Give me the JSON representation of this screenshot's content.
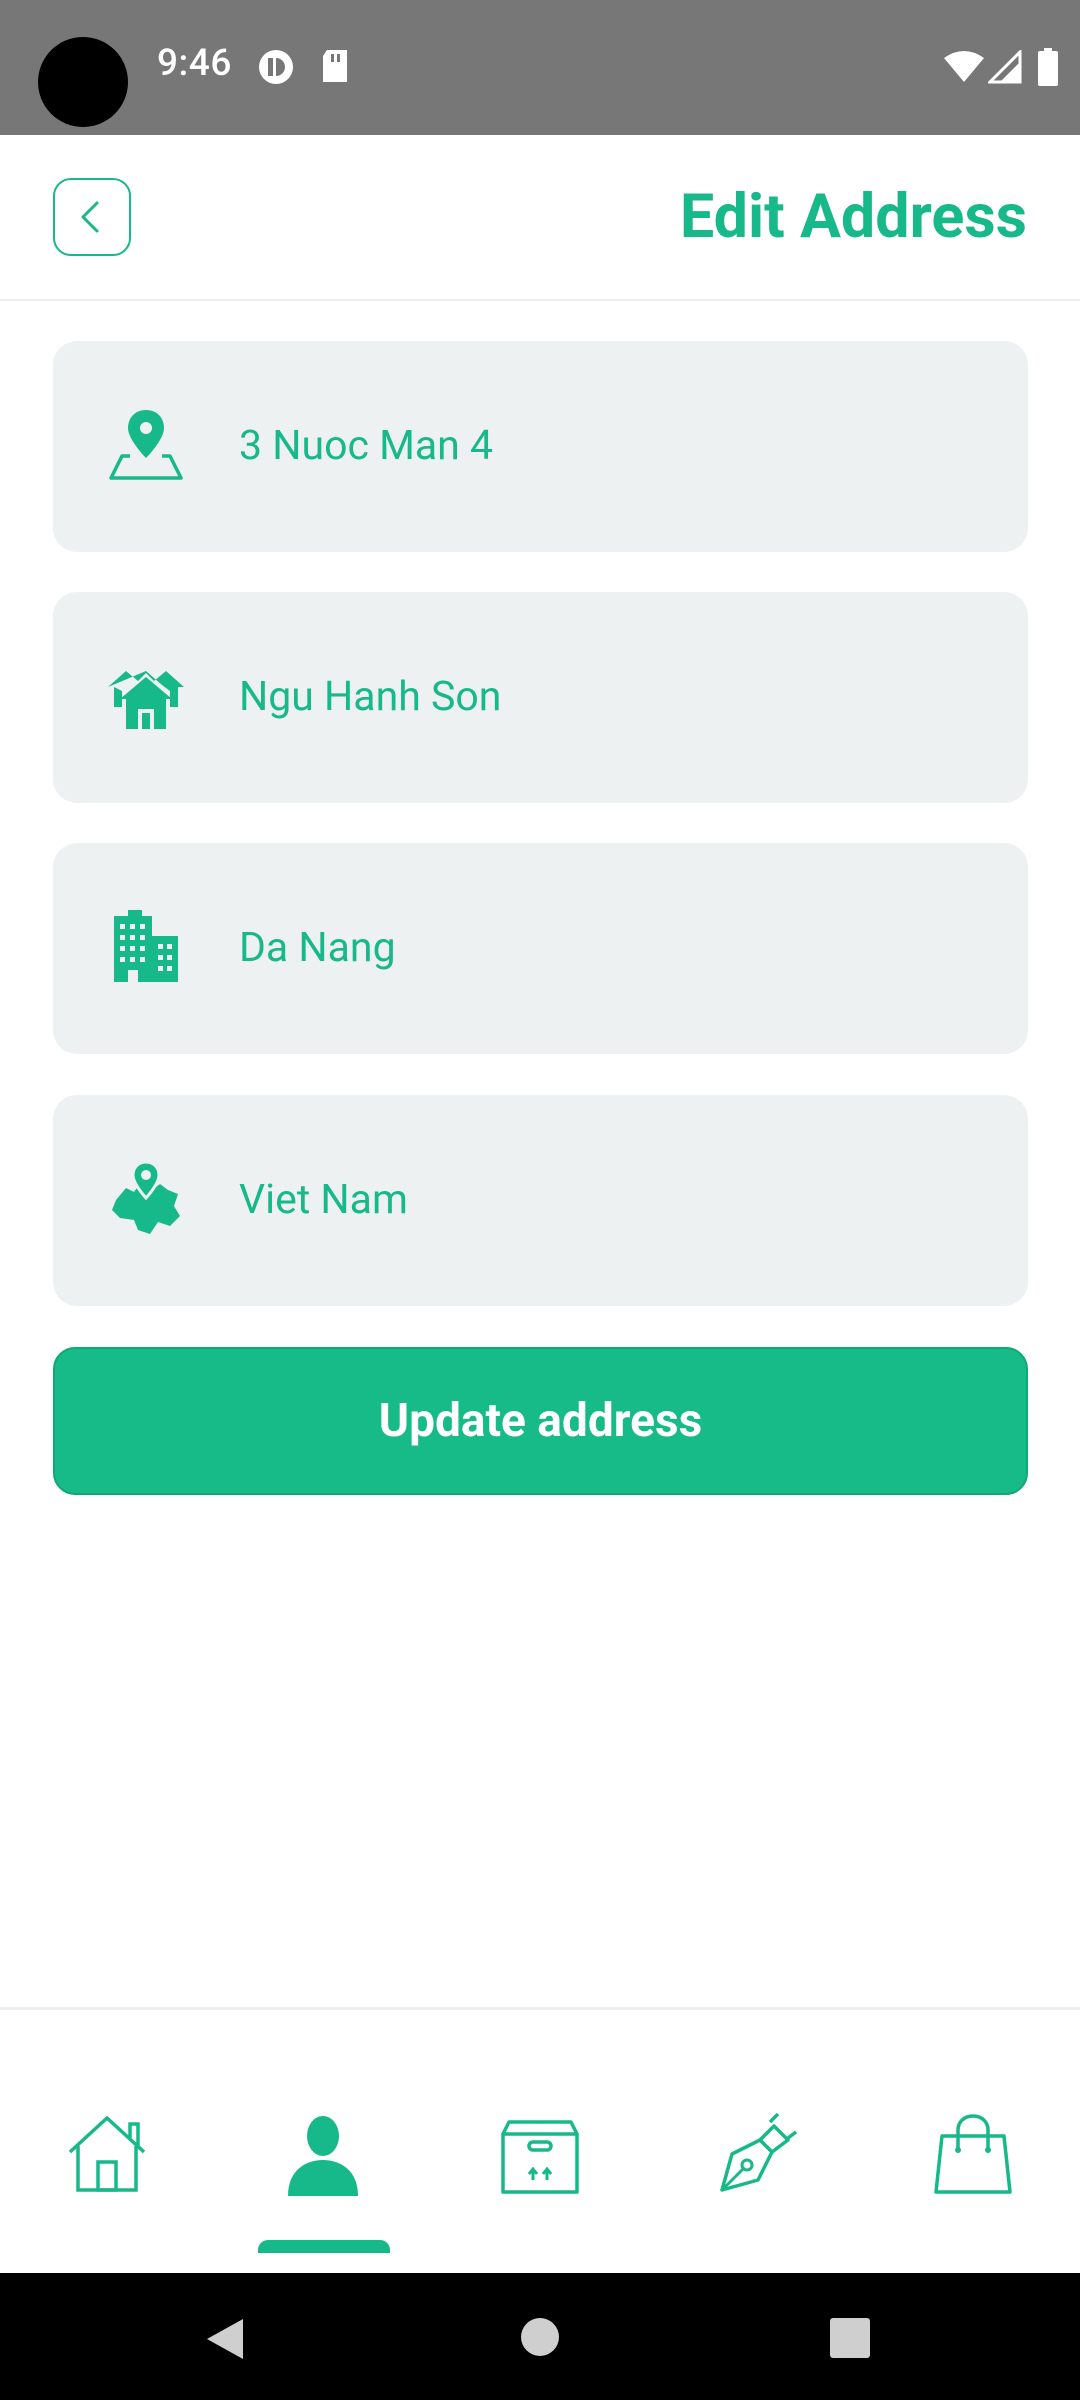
{
  "status_bar": {
    "time": "9:46"
  },
  "header": {
    "title": "Edit Address"
  },
  "address_form": {
    "fields": [
      {
        "icon": "map-pin-icon",
        "value": "3 Nuoc Man 4"
      },
      {
        "icon": "houses-icon",
        "value": "Ngu Hanh Son"
      },
      {
        "icon": "buildings-icon",
        "value": "Da Nang"
      },
      {
        "icon": "country-map-icon",
        "value": "Viet Nam"
      }
    ],
    "submit_label": "Update address"
  },
  "bottom_nav": {
    "items": [
      "home-icon",
      "profile-icon",
      "box-icon",
      "pen-icon",
      "shopping-bag-icon"
    ],
    "active_index": 1
  },
  "colors": {
    "accent": "#17b889",
    "field_bg": "#eef1f2",
    "status_bar": "#777777"
  }
}
